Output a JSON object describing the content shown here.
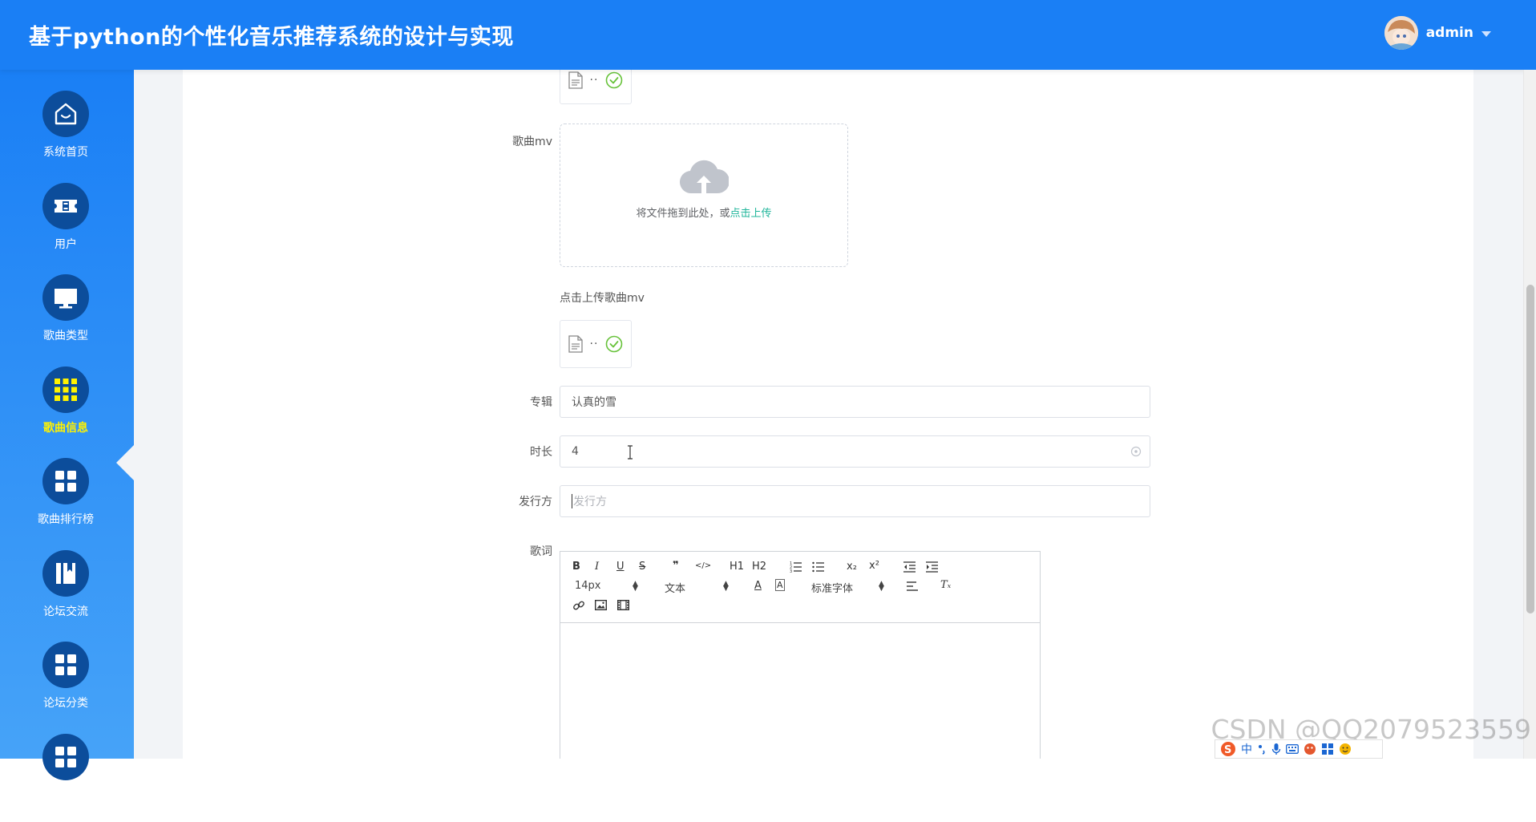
{
  "header": {
    "title": "基于python的个性化音乐推荐系统的设计与实现",
    "username": "admin"
  },
  "sidebar": {
    "items": [
      {
        "label": "系统首页",
        "icon": "home-icon"
      },
      {
        "label": "用户",
        "icon": "ticket-icon"
      },
      {
        "label": "歌曲类型",
        "icon": "monitor-icon"
      },
      {
        "label": "歌曲信息",
        "icon": "grid-icon",
        "active": true
      },
      {
        "label": "歌曲排行榜",
        "icon": "apps-icon"
      },
      {
        "label": "论坛交流",
        "icon": "book-icon"
      },
      {
        "label": "论坛分类",
        "icon": "apps-icon"
      }
    ]
  },
  "form": {
    "mv_label": "歌曲mv",
    "upload_text": "将文件拖到此处，或",
    "upload_link": "点击上传",
    "mv_hint": "点击上传歌曲mv",
    "file_dots": "··",
    "album_label": "专辑",
    "album_value": "认真的雪",
    "duration_label": "时长",
    "duration_value": "4",
    "publisher_label": "发行方",
    "publisher_placeholder": "发行方",
    "lyrics_label": "歌词"
  },
  "editor": {
    "font_size": "14px",
    "paragraph": "文本",
    "font_family": "标准字体",
    "h1": "H1",
    "h2": "H2",
    "bold": "B",
    "italic": "I",
    "underline": "U",
    "strike": "S",
    "quote": "❞",
    "code": "</>",
    "sub": "x₂",
    "sup": "x²",
    "clear_format": "Tₓ",
    "color": "A"
  },
  "watermark": "CSDN @QQ2079523559",
  "ime": {
    "mode": "中"
  },
  "colors": {
    "header_bg": "#1a7ff5",
    "sidebar_circle": "#0c4d9b",
    "active_label": "#fff200",
    "upload_link": "#1fb59a",
    "success_check": "#67c23a"
  }
}
